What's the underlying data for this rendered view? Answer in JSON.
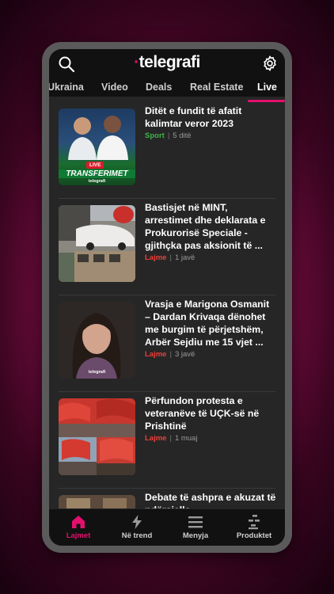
{
  "app": {
    "logo_text": "telegrafi",
    "accent_color": "#e3106c"
  },
  "tabs": [
    {
      "label": "Ukraina"
    },
    {
      "label": "Video"
    },
    {
      "label": "Deals"
    },
    {
      "label": "Real Estate"
    },
    {
      "label": "Live",
      "active": true
    }
  ],
  "articles": [
    {
      "title": "Ditët e fundit të afatit kalimtar veror 2023",
      "category": "Sport",
      "category_color": "#3bb54a",
      "time": "5 ditë",
      "thumb_badge": "LIVE",
      "thumb_banner": "TRANSFERIMET",
      "thumb_brand": "telegrafi"
    },
    {
      "title": "Bastisjet në MINT, arrestimet dhe deklarata e Prokurorisë Speciale - gjithçka pas aksionit të ...",
      "category": "Lajme",
      "category_color": "#e8403a",
      "time": "1 javë"
    },
    {
      "title": "Vrasja e Marigona Osmanit – Dardan Krivaqa dënohet me burgim të përjetshëm, Arbër Sejdiu me 15 vjet ...",
      "category": "Lajme",
      "category_color": "#e8403a",
      "time": "3 javë",
      "thumb_brand": "telegrafi"
    },
    {
      "title": "Përfundon protesta e veteranëve të UÇK-së në Prishtinë",
      "category": "Lajme",
      "category_color": "#e8403a",
      "time": "1 muaj"
    },
    {
      "title": "Debate të ashpra e akuzat të ndërsjella",
      "category": "",
      "time": ""
    }
  ],
  "bottom_nav": [
    {
      "label": "Lajmet",
      "icon": "home-icon",
      "active": true
    },
    {
      "label": "Në trend",
      "icon": "bolt-icon"
    },
    {
      "label": "Menyja",
      "icon": "menu-icon"
    },
    {
      "label": "Produktet",
      "icon": "products-icon"
    }
  ]
}
